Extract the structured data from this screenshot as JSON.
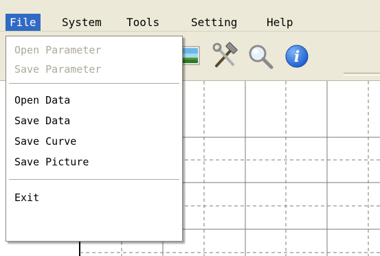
{
  "menubar": {
    "items": [
      {
        "label": "File"
      },
      {
        "label": "System"
      },
      {
        "label": "Tools"
      },
      {
        "label": "Setting"
      },
      {
        "label": "Help"
      }
    ]
  },
  "file_menu": {
    "items": [
      {
        "label": "Open Parameter",
        "enabled": false
      },
      {
        "label": "Save Parameter",
        "enabled": false
      },
      {
        "label": "Open Data",
        "enabled": true
      },
      {
        "label": "Save Data",
        "enabled": true
      },
      {
        "label": "Save Curve",
        "enabled": true
      },
      {
        "label": "Save Picture",
        "enabled": true
      },
      {
        "label": "Exit",
        "enabled": true
      }
    ]
  },
  "toolbar": {
    "buttons": [
      {
        "icon": "picture-icon"
      },
      {
        "icon": "tools-icon"
      },
      {
        "icon": "magnifier-icon"
      },
      {
        "icon": "info-icon"
      }
    ]
  },
  "colors": {
    "menu_highlight": "#316ac5",
    "chrome": "#ece9d8",
    "disabled_text": "#aca899",
    "info_blue": "#1f5fd1"
  }
}
